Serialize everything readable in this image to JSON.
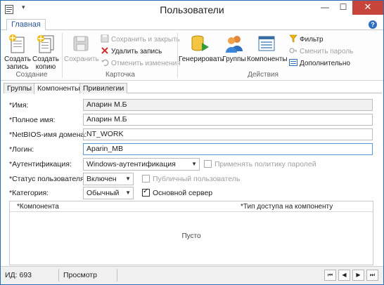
{
  "window": {
    "title": "Пользователи",
    "minimize_glyph": "—",
    "maximize_glyph": "☐",
    "close_glyph": "✕",
    "qat_arrow": "▾"
  },
  "ribbon": {
    "tab_label": "Главная",
    "help_glyph": "?",
    "groups": {
      "create": {
        "label": "Создание",
        "create_record": [
          "Создать",
          "запись"
        ],
        "create_copy": [
          "Создать",
          "копию"
        ]
      },
      "card": {
        "label": "Карточка",
        "save": "Сохранить",
        "save_and_close": "Сохранить и закрыть",
        "delete_record": "Удалить запись",
        "cancel_changes": "Отменить изменения"
      },
      "actions": {
        "label": "Действия",
        "generate": "Генерировать",
        "groups": "Группы",
        "components": "Компоненты",
        "filter": "Фильтр",
        "change_password": "Сменить пароль",
        "additional": "Дополнительно"
      }
    }
  },
  "tabs": [
    "Группы",
    "Компоненты",
    "Привилегии"
  ],
  "form": {
    "name_label": "*Имя:",
    "name_value": "Апарин М.Б",
    "fullname_label": "*Полное имя:",
    "fullname_value": "Апарин М.Б",
    "netbios_label": "*NetBIOS-имя домена:",
    "netbios_value": "NT_WORK",
    "login_label": "*Логин:",
    "login_value": "Aparin_MB",
    "auth_label": "*Аутентификация:",
    "auth_value": "Windows-аутентификация",
    "apply_policy_label": "Применять политику паролей",
    "status_label": "*Статус пользователя:",
    "status_value": "Включен",
    "public_user_label": "Публичный пользователь",
    "category_label": "*Категория:",
    "category_value": "Обычный",
    "main_server_label": "Основной сервер",
    "dropdown_arrow": "▼"
  },
  "grid": {
    "col_component": "*Компонента",
    "col_access_type": "*Тип доступа на компоненту",
    "empty_text": "Пусто"
  },
  "status": {
    "id_text": "ИД: 693",
    "mode_text": "Просмотр",
    "nav_first": "⏮",
    "nav_prev": "◀",
    "nav_next": "▶",
    "nav_last": "⏭"
  }
}
